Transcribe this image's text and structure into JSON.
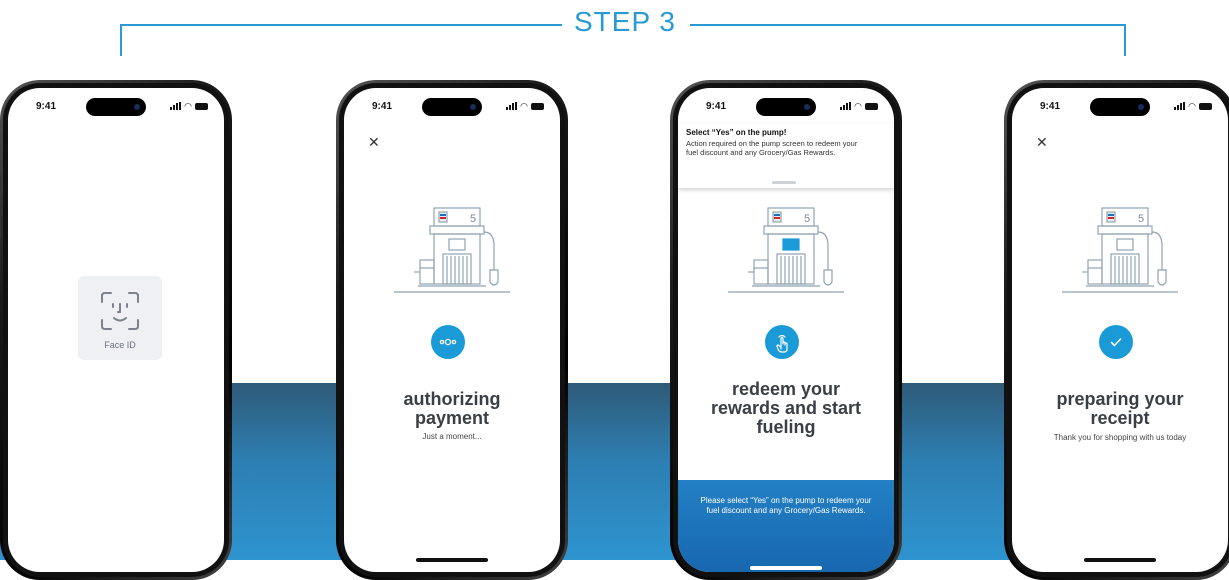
{
  "header": {
    "step_label": "STEP 3"
  },
  "status_bar": {
    "time": "9:41"
  },
  "screens": {
    "faceid": {
      "label": "Face ID"
    },
    "authorizing": {
      "title_line1": "authorizing",
      "title_line2": "payment",
      "subtitle": "Just a moment...",
      "icon": "dots-icon"
    },
    "redeem": {
      "notification_title": "Select “Yes” on the pump!",
      "notification_body": "Action required on the pump screen to redeem your fuel discount and any Grocery/Gas Rewards.",
      "title_line1": "redeem your",
      "title_line2": "rewards and start",
      "title_line3": "fueling",
      "footer_text": "Please select “Yes” on the pump to redeem your fuel discount and any Grocery/Gas Rewards.",
      "icon": "tap-hand-icon"
    },
    "receipt": {
      "title_line1": "preparing your",
      "title_line2": "receipt",
      "subtitle": "Thank you for shopping with us today",
      "icon": "checkmark-icon"
    }
  },
  "pump": {
    "number": "5"
  },
  "colors": {
    "accent": "#1b9ad8",
    "band": "#2e94cf",
    "pump_line": "#8fa3b3"
  }
}
